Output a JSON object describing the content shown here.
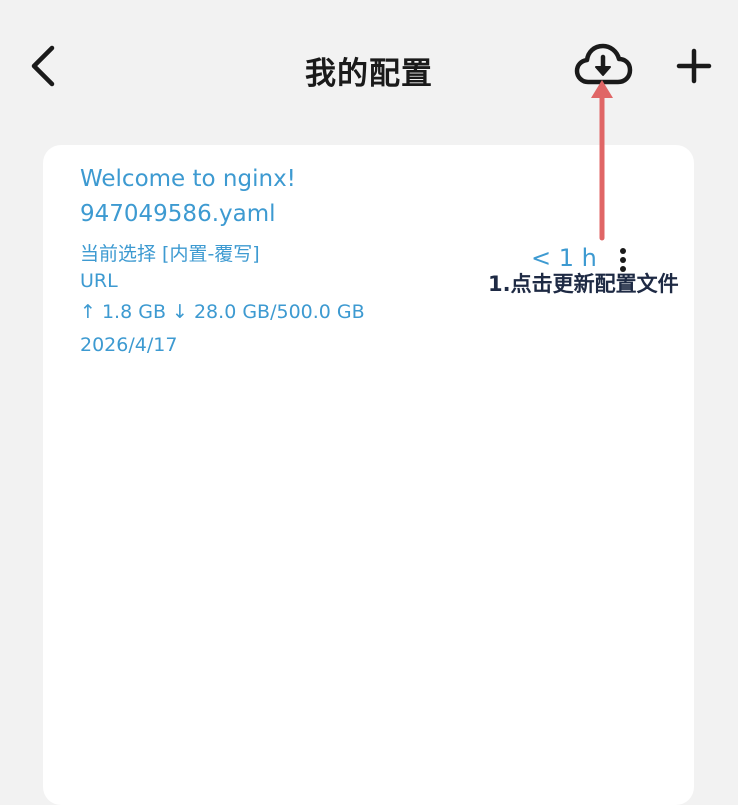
{
  "header": {
    "title": "我的配置",
    "back_icon": "chevron-left-icon",
    "update_icon": "cloud-download-icon",
    "add_icon": "plus-icon"
  },
  "profile": {
    "name": "Welcome to nginx!",
    "file": "947049586.yaml",
    "selection": "当前选择 [内置-覆写]",
    "type": "URL",
    "traffic": "↑ 1.8 GB ↓ 28.0 GB/500.0 GB",
    "date": "2026/4/17",
    "age": "< 1 h",
    "menu_icon": "more-vertical-icon",
    "text_color": "#3d9ad1"
  },
  "annotation": {
    "text": "1.点击更新配置文件",
    "arrow_color": "#e06666"
  }
}
